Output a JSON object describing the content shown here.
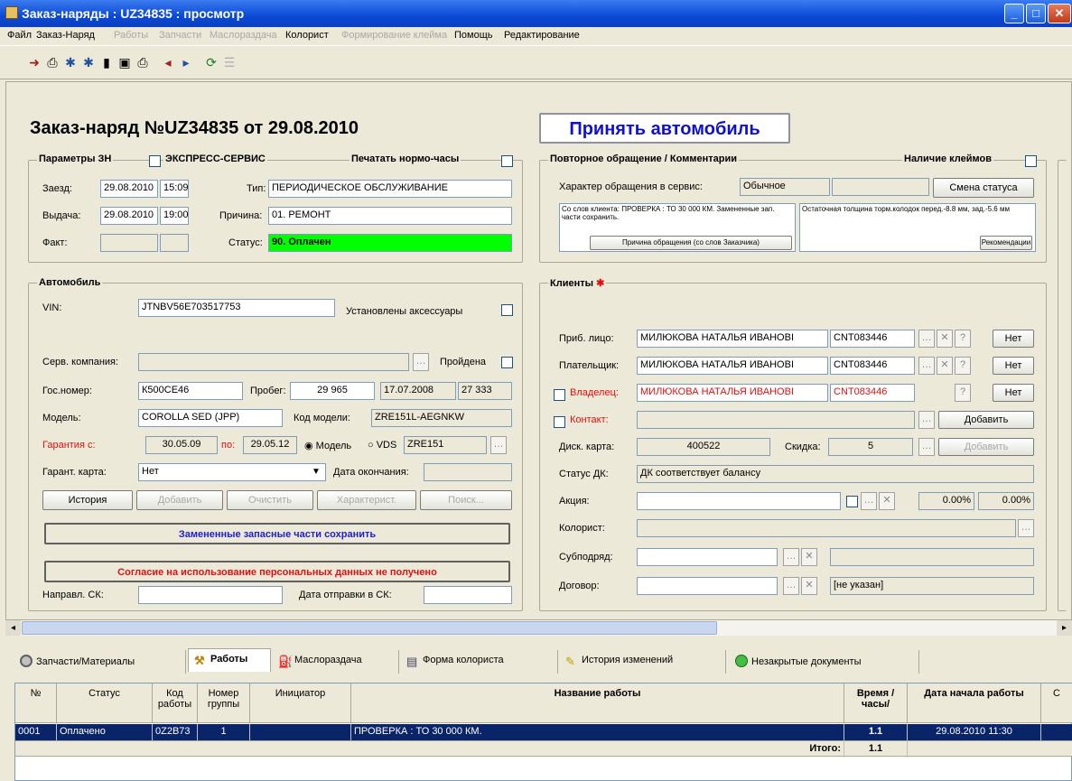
{
  "window": {
    "title": "Заказ-наряды : UZ34835 : просмотр"
  },
  "menu": [
    {
      "label": "Файл",
      "enabled": true
    },
    {
      "label": "Заказ-Наряд",
      "enabled": true
    },
    {
      "label": "Работы",
      "enabled": false
    },
    {
      "label": "Запчасти",
      "enabled": false
    },
    {
      "label": "Маслораздача",
      "enabled": false
    },
    {
      "label": "Колорист",
      "enabled": true
    },
    {
      "label": "Формирование клейма",
      "enabled": false
    },
    {
      "label": "Помощь",
      "enabled": true
    },
    {
      "label": "Редактирование",
      "enabled": true
    }
  ],
  "header": {
    "order_title": "Заказ-наряд №UZ34835 от 29.08.2010",
    "accept_button": "Принять автомобиль"
  },
  "params": {
    "group_label": "Параметры ЗН",
    "express_label": "ЭКСПРЕСС-СЕРВИС",
    "print_hours_label": "Печатать нормо-часы",
    "arrival_label": "Заезд:",
    "arrival_date": "29.08.2010",
    "arrival_time": "15:09",
    "type_label": "Тип:",
    "type_value": "ПЕРИОДИЧЕСКОЕ ОБСЛУЖИВАНИЕ",
    "issue_label": "Выдача:",
    "issue_date": "29.08.2010",
    "issue_time": "19:00",
    "reason_label": "Причина:",
    "reason_value": "01. РЕМОНТ",
    "fact_label": "Факт:",
    "status_label": "Статус:",
    "status_value": "90. Оплачен"
  },
  "repeat": {
    "group_label": "Повторное обращение / Комментарии",
    "stamps_label": "Наличие клеймов",
    "nature_label": "Характер обращения в сервис:",
    "nature_value": "Обычное",
    "status_change_button": "Смена статуса",
    "client_words": "Со слов клиента: ПРОВЕРКА : ТО 30 000 КМ. Замененные зап. части сохранить.",
    "client_reason_button": "Причина обращения (со слов Заказчика)",
    "recommendation_text": "Остаточная толщина торм.колодок перед.-8.8 мм, зад.-5.6 мм",
    "recommendation_button": "Рекомендации"
  },
  "car": {
    "group_label": "Автомобиль",
    "vin_label": "VIN:",
    "vin_value": "JTNBV56E703517753",
    "accessories_label": "Установлены аксессуары",
    "service_company_label": "Серв. компания:",
    "passed_label": "Пройдена",
    "plate_label": "Гос.номер:",
    "plate_value": "К500СЕ46",
    "mileage_label": "Пробег:",
    "mileage_value": "29 965",
    "mileage_date": "17.07.2008",
    "mileage_prev": "27 333",
    "model_label": "Модель:",
    "model_value": "COROLLA SED    (JPP)",
    "model_code_label": "Код модели:",
    "model_code_value": "ZRE151L-AEGNKW",
    "warranty_from_label": "Гарантия с:",
    "warranty_from": "30.05.09",
    "warranty_to_label": "по:",
    "warranty_to": "29.05.12",
    "radio_model": "Модель",
    "radio_vds": "VDS",
    "vds_value": "ZRE151",
    "warranty_card_label": "Гарант. карта:",
    "warranty_card_value": "Нет",
    "end_date_label": "Дата окончания:",
    "buttons": [
      "История",
      "Добавить",
      "Очистить",
      "Характерист.",
      "Поиск..."
    ],
    "replaced_parts_notice": "Замененные запасные части сохранить",
    "consent_notice": "Согласие на использование персональных данных не получено",
    "direction_label": "Направл. СК:",
    "send_date_label": "Дата отправки в СК:"
  },
  "clients": {
    "group_label": "Клиенты",
    "trusted_label": "Приб. лицо:",
    "trusted_name": "МИЛЮКОВА НАТАЛЬЯ ИВАНОВІ",
    "trusted_code": "CNT083446",
    "payer_label": "Плательщик:",
    "payer_name": "МИЛЮКОВА НАТАЛЬЯ ИВАНОВІ",
    "payer_code": "CNT083446",
    "owner_label": "Владелец:",
    "owner_name": "МИЛЮКОВА НАТАЛЬЯ ИВАНОВІ",
    "owner_code": "CNT083446",
    "no_label": "Нет",
    "contact_label": "Контакт:",
    "add_label": "Добавить",
    "disc_card_label": "Диск. карта:",
    "disc_card_value": "400522",
    "discount_label": "Скидка:",
    "discount_value": "5",
    "dk_status_label": "Статус ДК:",
    "dk_status_value": "ДК соответствует балансу",
    "promo_label": "Акция:",
    "promo_pct1": "0.00%",
    "promo_pct2": "0.00%",
    "colorist_label": "Колорист:",
    "subcontract_label": "Субподряд:",
    "contract_label": "Договор:",
    "contract_value": "[не указан]"
  },
  "tabs": [
    {
      "label": "Запчасти/Материалы",
      "active": false
    },
    {
      "label": "Работы",
      "active": true
    },
    {
      "label": "Маслораздача",
      "active": false
    },
    {
      "label": "Форма колориста",
      "active": false
    },
    {
      "label": "История изменений",
      "active": false
    },
    {
      "label": "Незакрытые документы",
      "active": false
    }
  ],
  "works_table": {
    "headers": [
      "№",
      "Статус",
      "Код работы",
      "Номер группы",
      "Инициатор",
      "Название работы",
      "Время /часы/",
      "Дата начала работы",
      "С"
    ],
    "rows": [
      [
        "0001",
        "Оплачено",
        "0Z2B73",
        "1",
        "",
        "ПРОВЕРКА : ТО 30 000 КМ.",
        "1.1",
        "29.08.2010 11:30",
        ""
      ]
    ],
    "total_label": "Итого:",
    "total_value": "1.1"
  },
  "colors": {
    "status_ok": "#00ff00",
    "selection": "#0a246a",
    "title_blue": "#1010d0"
  }
}
